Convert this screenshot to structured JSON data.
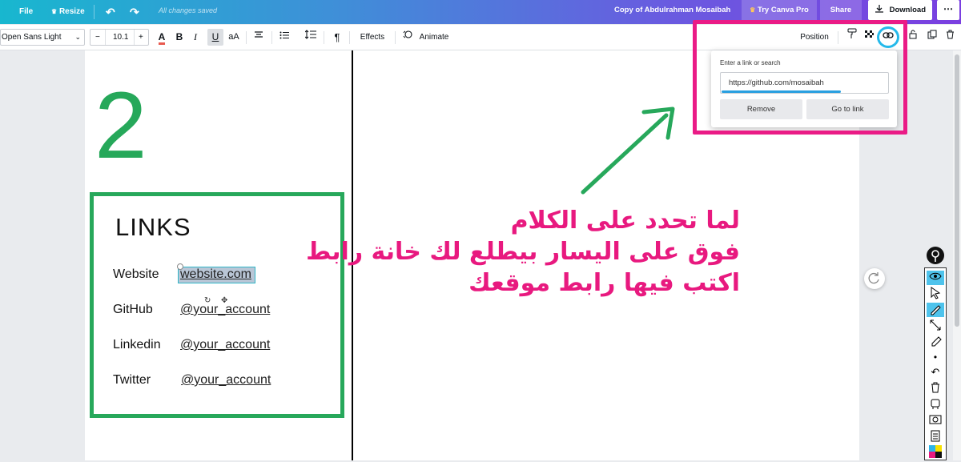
{
  "topbar": {
    "file": "File",
    "resize": "Resize",
    "saved_status": "All changes saved",
    "doc_title": "Copy of Abdulrahman Mosaibah",
    "try_pro": "Try Canva Pro",
    "share": "Share",
    "download": "Download"
  },
  "toolbar": {
    "font": "Open Sans Light",
    "font_size": "10.1",
    "minus": "−",
    "plus": "+",
    "color_letter": "A",
    "bold": "B",
    "italic": "I",
    "underline": "U",
    "case": "aA",
    "effects": "Effects",
    "animate": "Animate",
    "position": "Position"
  },
  "canvas": {
    "big_number": "2",
    "links_title": "LINKS",
    "rows": [
      {
        "label": "Website",
        "value": "website.com"
      },
      {
        "label": "GitHub",
        "value": "@your_account"
      },
      {
        "label": "Linkedin",
        "value": "@your_account"
      },
      {
        "label": "Twitter",
        "value": "@your_account"
      }
    ],
    "arabic_lines": [
      "لما تحدد على الكلام",
      "فوق على اليسار بيطلع لك خانة رابط",
      "اكتب فيها رابط موقعك"
    ]
  },
  "link_popup": {
    "label": "Enter a link or search",
    "value": "https://github.com/mosaibah",
    "remove": "Remove",
    "go_to_link": "Go to link"
  },
  "colors": {
    "green_box": "#27a85b",
    "pink_highlight": "#ea1b86",
    "link_circle": "#25b9ea",
    "arabic_text": "#e8197f"
  }
}
